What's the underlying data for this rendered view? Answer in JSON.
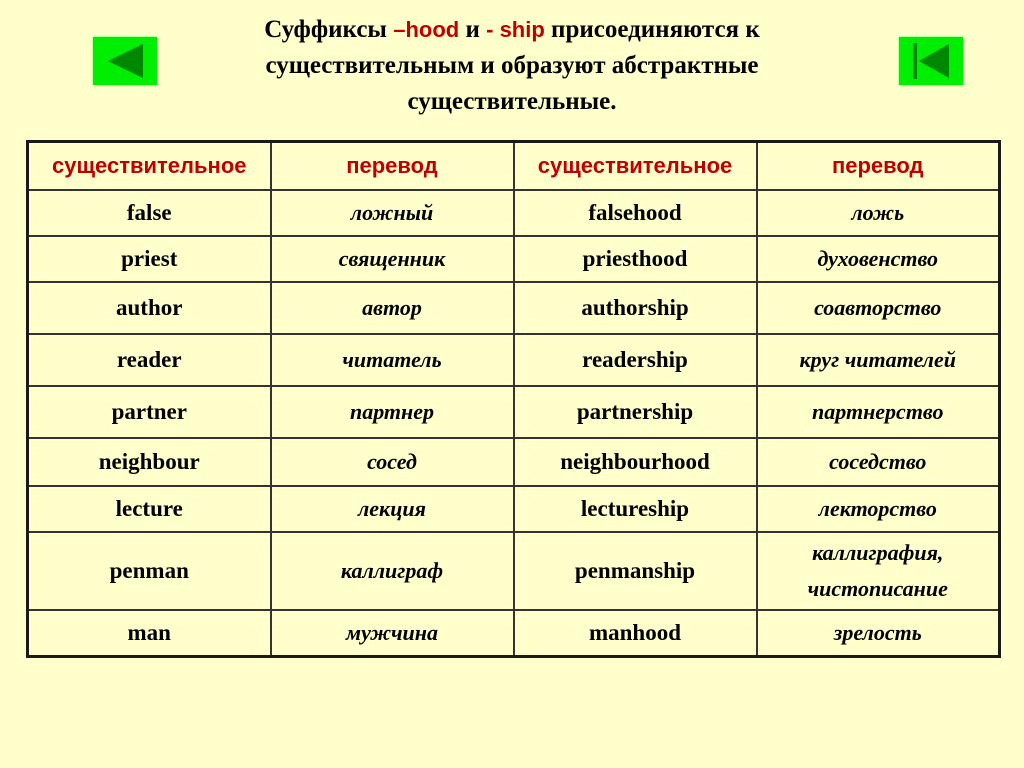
{
  "nav": {
    "back_icon": "triangle-left-icon",
    "first_icon": "skip-to-start-icon",
    "color": "#00EE00",
    "icon_color": "#008800"
  },
  "title": {
    "part1": "Суффиксы ",
    "suffix1": "–hood",
    "part2": " и ",
    "suffix2": "- ship",
    "part3": " присоединяются к существительным и образуют абстрактные существительные."
  },
  "table": {
    "headers": [
      "существительное",
      "перевод",
      "существительное",
      "перевод"
    ],
    "rows": [
      {
        "noun": "false",
        "noun_tr": "ложный",
        "derived": "falsehood",
        "derived_tr": "ложь"
      },
      {
        "noun": "priest",
        "noun_tr": "священник",
        "derived": "priesthood",
        "derived_tr": "духовенство"
      },
      {
        "noun": "author",
        "noun_tr": "автор",
        "derived": "authorship",
        "derived_tr": "соавторство"
      },
      {
        "noun": "reader",
        "noun_tr": "читатель",
        "derived": "readership",
        "derived_tr": "круг читателей"
      },
      {
        "noun": "partner",
        "noun_tr": "партнер",
        "derived": "partnership",
        "derived_tr": "партнерство"
      },
      {
        "noun": "neighbour",
        "noun_tr": "сосед",
        "derived": "neighbourhood",
        "derived_tr": "соседство"
      },
      {
        "noun": "lecture",
        "noun_tr": "лекция",
        "derived": "lectureship",
        "derived_tr": "лекторство"
      },
      {
        "noun": "penman",
        "noun_tr": "каллиграф",
        "derived": "penmanship",
        "derived_tr": "каллиграфия, чистописание"
      },
      {
        "noun": "man",
        "noun_tr": "мужчина",
        "derived": "manhood",
        "derived_tr": "зрелость"
      }
    ]
  },
  "colors": {
    "background": "#FFFFCC",
    "accent_red": "#C00000"
  }
}
